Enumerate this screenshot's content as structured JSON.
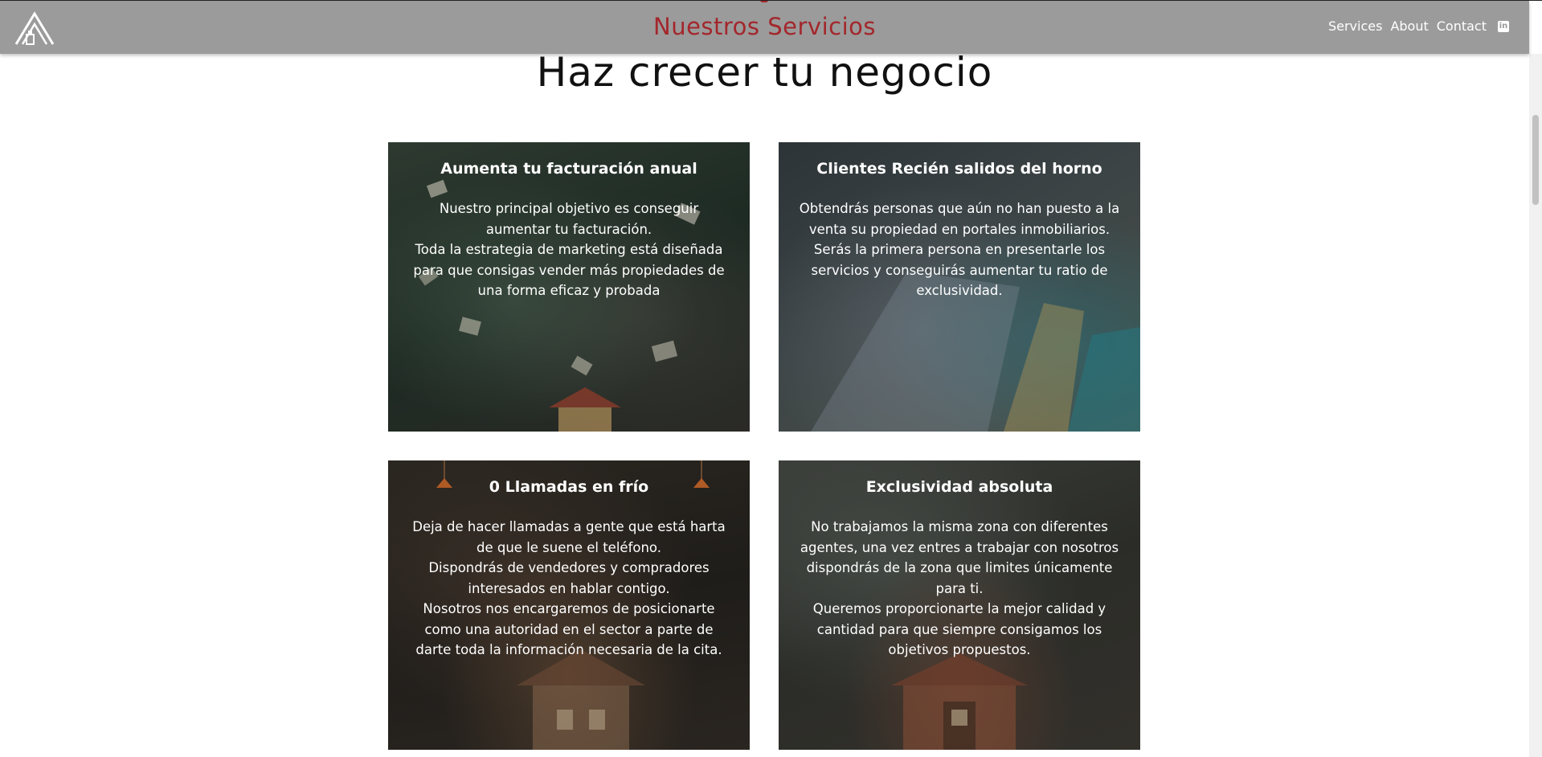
{
  "navbar": {
    "title": "Nuestros Servicios",
    "links": [
      "Services",
      "About",
      "Contact"
    ],
    "logo_icon": "house-roof-logo",
    "social_icon": "linkedin-icon",
    "social_glyph": "in",
    "background_color": "#9b9b9b",
    "title_color": "#a3272c"
  },
  "main": {
    "heading": "Haz crecer tu negocio",
    "cards": [
      {
        "title": "Aumenta tu facturación anual",
        "paragraphs": [
          "Nuestro principal objetivo es conseguir aumentar tu facturación.",
          "Toda la estrategia de marketing está diseñada para que consigas vender más propiedades de una forma eficaz y probada"
        ]
      },
      {
        "title": "Clientes Recién salidos del horno",
        "paragraphs": [
          "Obtendrás personas que aún no han puesto a la venta su propiedad en portales inmobiliarios. Serás la primera persona en presentarle los servicios y conseguirás aumentar tu ratio de exclusividad."
        ]
      },
      {
        "title": "0 Llamadas en frío",
        "paragraphs": [
          "Deja de hacer llamadas a gente que está harta de que le suene el teléfono.",
          "Dispondrás de vendedores y compradores interesados en hablar contigo.",
          "Nosotros nos encargaremos de posicionarte como una autoridad en el sector a parte de darte toda la información necesaria de la cita."
        ]
      },
      {
        "title": "Exclusividad absoluta",
        "paragraphs": [
          "No trabajamos la misma zona con diferentes agentes, una vez entres a trabajar con nosotros dispondrás de la zona que limites únicamente para ti.",
          "Queremos proporcionarte la mejor calidad y cantidad para que siempre consigamos los objetivos propuestos."
        ]
      }
    ]
  }
}
